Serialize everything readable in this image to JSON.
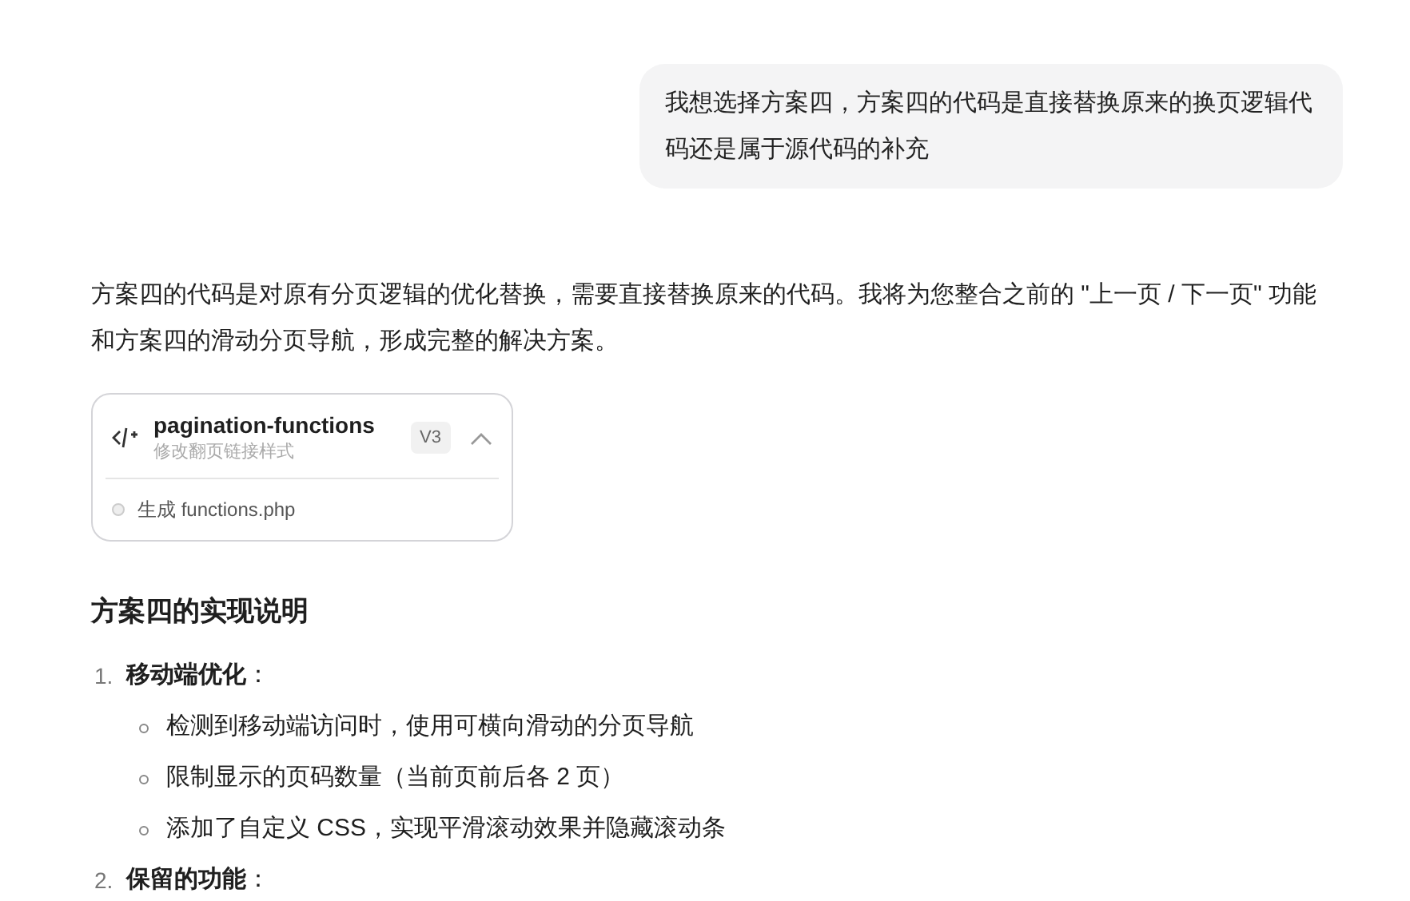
{
  "user_message": "我想选择方案四，方案四的代码是直接替换原来的换页逻辑代码还是属于源代码的补充",
  "reply_paragraph": "方案四的代码是对原有分页逻辑的优化替换，需要直接替换原来的代码。我将为您整合之前的 \"上一页 / 下一页\" 功能和方案四的滑动分页导航，形成完整的解决方案。",
  "artifact_card": {
    "title": "pagination-functions",
    "subtitle": "修改翻页链接样式",
    "version": "V3",
    "expanded": true,
    "step": "生成 functions.php"
  },
  "heading": "方案四的实现说明",
  "list": [
    {
      "number": "1.",
      "title": "**移动端优化**：",
      "children": [
        "检测到移动端访问时，使用可横向滑动的分页导航",
        "限制显示的页码数量（当前页前后各 2 页）",
        "添加了自定义 CSS，实现平滑滚动效果并隐藏滚动条"
      ]
    },
    {
      "number": "2.",
      "title": "**保留的功能**："
    }
  ]
}
